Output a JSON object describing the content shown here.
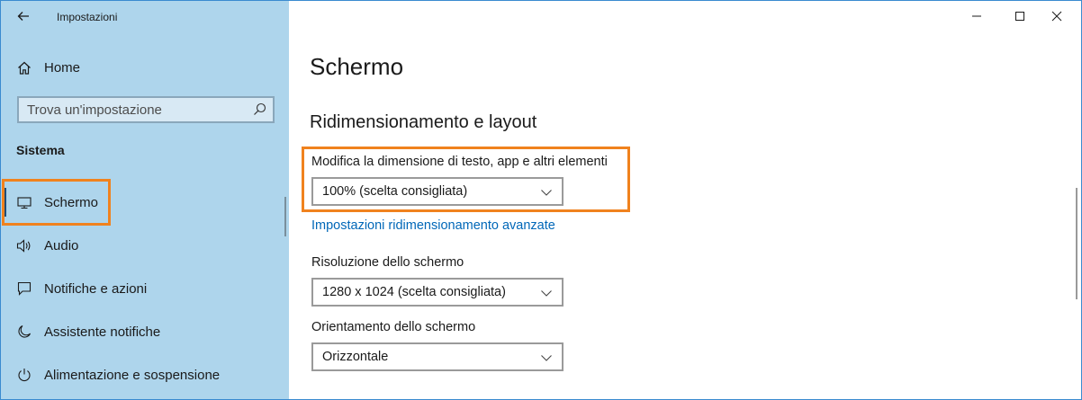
{
  "window": {
    "title": "Impostazioni"
  },
  "sidebar": {
    "home_label": "Home",
    "search_placeholder": "Trova un'impostazione",
    "section_title": "Sistema",
    "items": [
      {
        "label": "Schermo",
        "icon": "monitor-icon",
        "selected": true
      },
      {
        "label": "Audio",
        "icon": "speaker-icon"
      },
      {
        "label": "Notifiche e azioni",
        "icon": "notification-icon"
      },
      {
        "label": "Assistente notifiche",
        "icon": "moon-icon"
      },
      {
        "label": "Alimentazione e sospensione",
        "icon": "power-icon"
      }
    ]
  },
  "main": {
    "page_title": "Schermo",
    "section_title": "Ridimensionamento e layout",
    "scale": {
      "label": "Modifica la dimensione di testo, app e altri elementi",
      "value": "100% (scelta consigliata)"
    },
    "advanced_link": "Impostazioni ridimensionamento avanzate",
    "resolution": {
      "label": "Risoluzione dello schermo",
      "value": "1280 x 1024 (scelta consigliata)"
    },
    "orientation": {
      "label": "Orientamento dello schermo",
      "value": "Orizzontale"
    }
  },
  "colors": {
    "sidebar_bg": "#aed5ec",
    "highlight": "#f0821e",
    "link": "#0067b8"
  }
}
